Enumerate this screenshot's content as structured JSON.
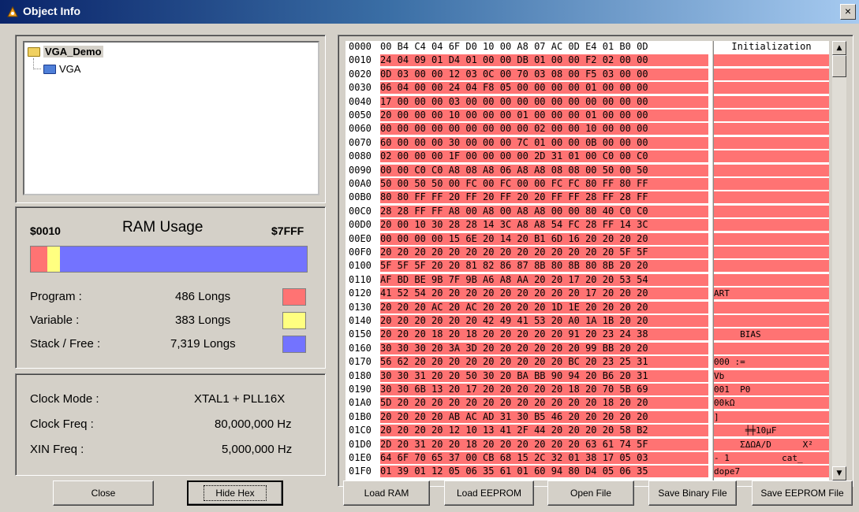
{
  "window": {
    "title": "Object Info",
    "close_glyph": "×"
  },
  "tree": {
    "root": "VGA_Demo",
    "child": "VGA"
  },
  "ram": {
    "start": "$0010",
    "title": "RAM Usage",
    "end": "$7FFF",
    "bar_fractions": {
      "program": 0.0594,
      "variable": 0.0468,
      "free": 0.8938
    },
    "rows": [
      {
        "label": "Program :",
        "value": "486 Longs",
        "color": "#ff7373"
      },
      {
        "label": "Variable :",
        "value": "383 Longs",
        "color": "#ffff80"
      },
      {
        "label": "Stack / Free :",
        "value": "7,319 Longs",
        "color": "#7373ff"
      }
    ]
  },
  "clock": {
    "rows": [
      {
        "label": "Clock Mode :",
        "value": "XTAL1 + PLL16X"
      },
      {
        "label": "Clock Freq :",
        "value": "80,000,000 Hz"
      },
      {
        "label": "XIN Freq :",
        "value": "5,000,000 Hz"
      }
    ]
  },
  "hex": {
    "rows": [
      {
        "addr": "0000",
        "bytes": "00 B4 C4 04 6F D0 10 00 A8 07 AC 0D E4 01 B0 0D"
      },
      {
        "addr": "0010",
        "bytes": "24 04 09 01 D4 01 00 00 DB 01 00 00 F2 02 00 00"
      },
      {
        "addr": "0020",
        "bytes": "0D 03 00 00 12 03 0C 00 70 03 08 00 F5 03 00 00"
      },
      {
        "addr": "0030",
        "bytes": "06 04 00 00 24 04 F8 05 00 00 00 00 01 00 00 00"
      },
      {
        "addr": "0040",
        "bytes": "17 00 00 00 03 00 00 00 00 00 00 00 00 00 00 00"
      },
      {
        "addr": "0050",
        "bytes": "20 00 00 00 10 00 00 00 01 00 00 00 01 00 00 00"
      },
      {
        "addr": "0060",
        "bytes": "00 00 00 00 00 00 00 00 00 02 00 00 10 00 00 00"
      },
      {
        "addr": "0070",
        "bytes": "60 00 00 00 30 00 00 00 7C 01 00 00 0B 00 00 00"
      },
      {
        "addr": "0080",
        "bytes": "02 00 00 00 1F 00 00 00 00 2D 31 01 00 C0 00 C0"
      },
      {
        "addr": "0090",
        "bytes": "00 00 C0 C0 A8 08 A8 06 A8 A8 08 08 00 50 00 50"
      },
      {
        "addr": "00A0",
        "bytes": "50 00 50 50 00 FC 00 FC 00 00 FC FC 80 FF 80 FF"
      },
      {
        "addr": "00B0",
        "bytes": "80 80 FF FF 20 FF 20 FF 20 20 FF FF 28 FF 28 FF"
      },
      {
        "addr": "00C0",
        "bytes": "28 28 FF FF A8 00 A8 00 A8 A8 00 00 80 40 C0 C0"
      },
      {
        "addr": "00D0",
        "bytes": "20 00 10 30 28 28 14 3C A8 A8 54 FC 28 FF 14 3C"
      },
      {
        "addr": "00E0",
        "bytes": "00 00 00 00 15 6E 20 14 20 B1 6D 16 20 20 20 20"
      },
      {
        "addr": "00F0",
        "bytes": "20 20 20 20 20 20 20 20 20 20 20 20 20 20 5F 5F"
      },
      {
        "addr": "0100",
        "bytes": "5F 5F 5F 20 20 81 82 86 87 8B 80 8B 80 8B 20 20"
      },
      {
        "addr": "0110",
        "bytes": "AF BD BE 9B 7F 9B A6 A8 AA 20 20 17 20 20 53 54"
      },
      {
        "addr": "0120",
        "bytes": "41 52 54 20 20 20 20 20 20 20 20 20 17 20 20 20"
      },
      {
        "addr": "0130",
        "bytes": "20 20 20 AC 20 AC 20 20 20 20 1D 1E 20 20 20 20"
      },
      {
        "addr": "0140",
        "bytes": "20 20 20 20 20 20 42 49 41 53 20 A0 1A 1B 20 20"
      },
      {
        "addr": "0150",
        "bytes": "20 20 20 18 20 18 20 20 20 20 20 91 20 23 24 38"
      },
      {
        "addr": "0160",
        "bytes": "30 30 30 20 3A 3D 20 20 20 20 20 20 99 BB 20 20"
      },
      {
        "addr": "0170",
        "bytes": "56 62 20 20 20 20 20 20 20 20 20 BC 20 23 25 31"
      },
      {
        "addr": "0180",
        "bytes": "30 30 31 20 20 50 30 20 BA BB 90 94 20 B6 20 31"
      },
      {
        "addr": "0190",
        "bytes": "30 30 6B 13 20 17 20 20 20 20 20 18 20 70 5B 69"
      },
      {
        "addr": "01A0",
        "bytes": "5D 20 20 20 20 20 20 20 20 20 20 20 20 18 20 20"
      },
      {
        "addr": "01B0",
        "bytes": "20 20 20 20 AB AC AD 31 30 B5 46 20 20 20 20 20"
      },
      {
        "addr": "01C0",
        "bytes": "20 20 20 20 12 10 13 41 2F 44 20 20 20 20 58 B2"
      },
      {
        "addr": "01D0",
        "bytes": "2D 20 31 20 20 18 20 20 20 20 20 20 63 61 74 5F"
      },
      {
        "addr": "01E0",
        "bytes": "64 6F 70 65 37 00 CB 68 15 2C 32 01 38 17 05 03"
      },
      {
        "addr": "01F0",
        "bytes": "01 39 01 12 05 06 35 61 01 60 94 80 D4 05 06 35"
      }
    ],
    "ascii_header": "Initialization",
    "ascii_rows": [
      "",
      "",
      "",
      "",
      "",
      "",
      "",
      "",
      "",
      "",
      "",
      "",
      "",
      "",
      "",
      "",
      "",
      "",
      "ART",
      "",
      "",
      "     BIAS",
      "",
      "000 :=",
      "Vb",
      "001  P0",
      "00kΩ",
      "]",
      "      ╪╪10µF",
      "     ΣΔΩA/D      X²",
      "- 1          cat_",
      "dope7"
    ]
  },
  "buttons": {
    "close": "Close",
    "hide_hex": "Hide Hex",
    "load_ram": "Load RAM",
    "load_eeprom": "Load EEPROM",
    "open_file": "Open File",
    "save_binary": "Save Binary File",
    "save_eeprom": "Save EEPROM File"
  },
  "colors": {
    "program": "#ff7373",
    "variable": "#ffff80",
    "free": "#7373ff"
  }
}
